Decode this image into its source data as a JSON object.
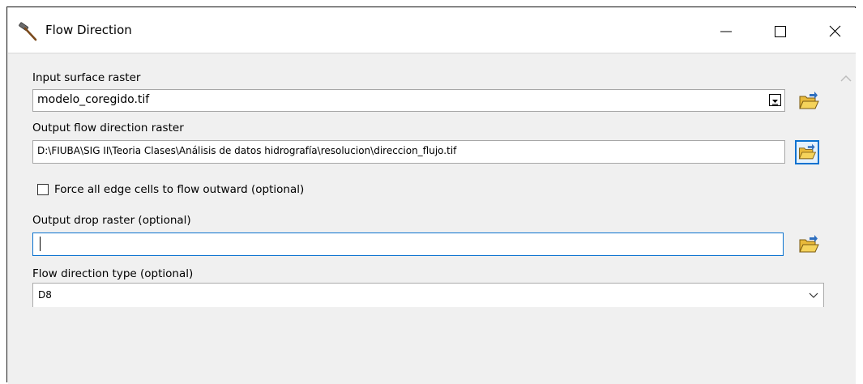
{
  "window": {
    "title": "Flow Direction"
  },
  "form": {
    "input_surface_raster": {
      "label": "Input surface raster",
      "value": "modelo_coregido.tif"
    },
    "output_flow_direction_raster": {
      "label": "Output flow direction raster",
      "value": "D:\\FIUBA\\SIG II\\Teoria Clases\\Análisis de datos hidrografía\\resolucion\\direccion_flujo.tif"
    },
    "force_edge_cells": {
      "label": "Force all edge cells to flow outward (optional)",
      "checked": false
    },
    "output_drop_raster": {
      "label": "Output drop raster (optional)",
      "value": ""
    },
    "flow_direction_type": {
      "label": "Flow direction type (optional)",
      "value": "D8"
    }
  },
  "icons": {
    "tool": "hammer-icon",
    "browse": "folder-open-icon",
    "minimize": "minimize-icon",
    "maximize": "maximize-icon",
    "close": "close-icon",
    "scroll_up": "chevron-up-icon",
    "dropdown": "chevron-down-icon"
  },
  "colors": {
    "focus_blue": "#0a72d0",
    "dialog_bg": "#f0f0f0",
    "folder_yellow": "#f5d35b"
  }
}
